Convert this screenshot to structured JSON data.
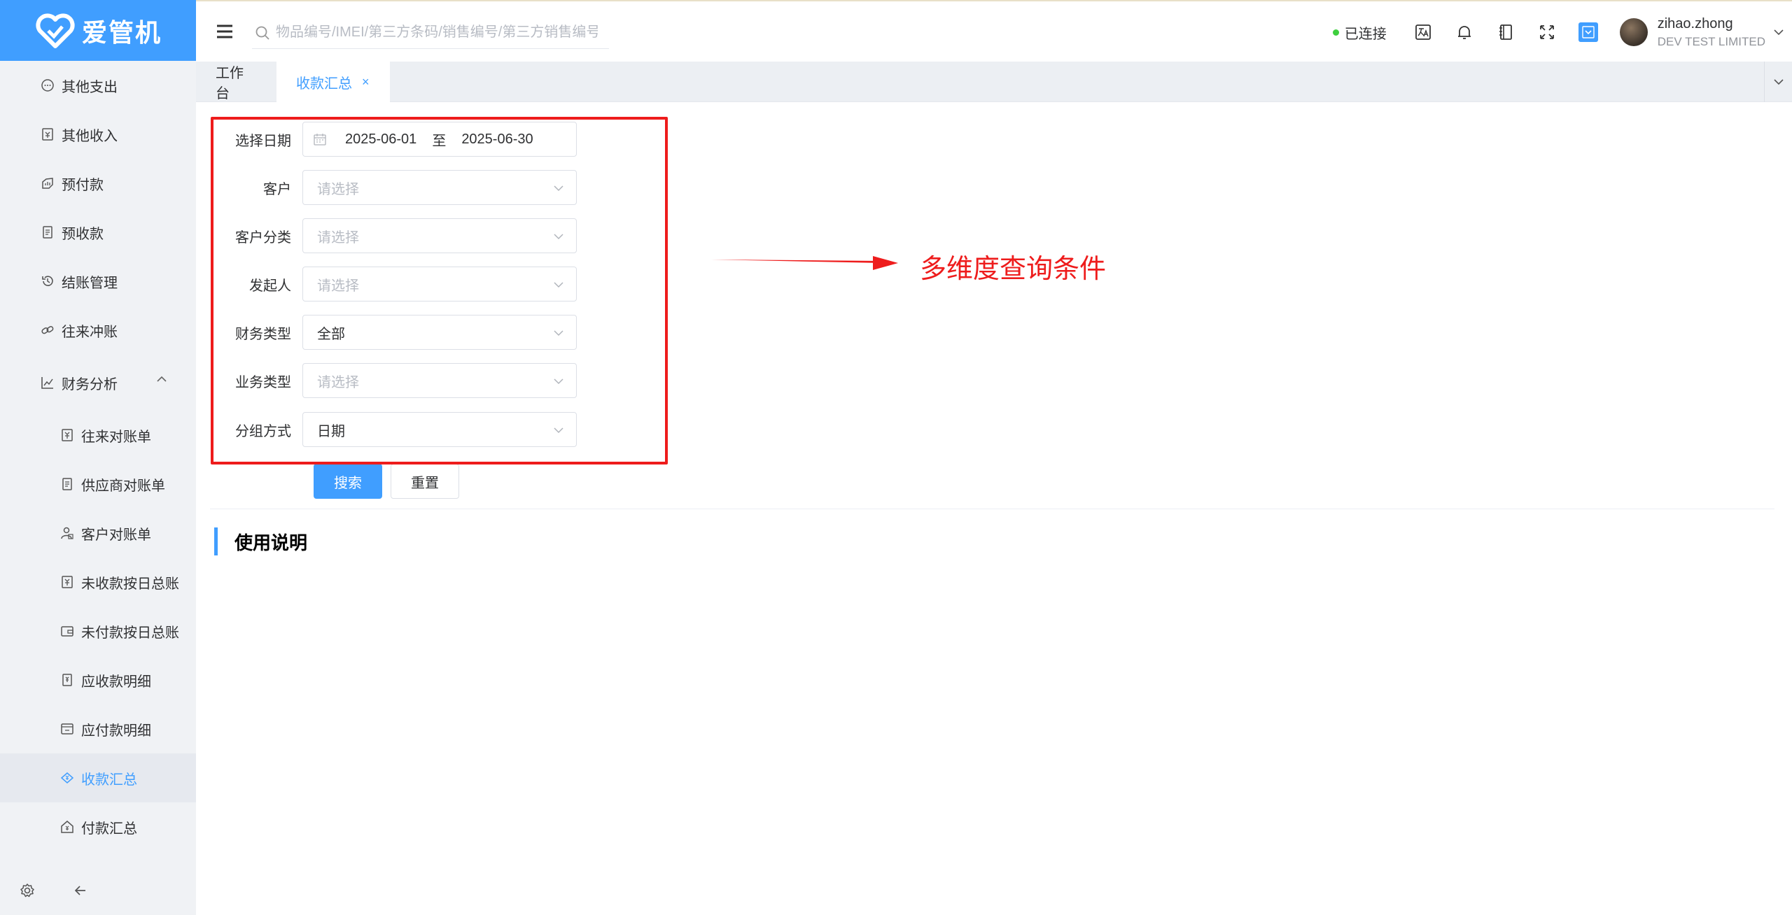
{
  "app": {
    "brand": "爱管机"
  },
  "sidebar": {
    "items": [
      {
        "label": "其他支出",
        "icon": "other-expense-icon"
      },
      {
        "label": "其他收入",
        "icon": "other-income-icon"
      },
      {
        "label": "预付款",
        "icon": "prepayment-icon"
      },
      {
        "label": "预收款",
        "icon": "advance-receipt-icon"
      },
      {
        "label": "结账管理",
        "icon": "history-icon"
      },
      {
        "label": "往来冲账",
        "icon": "link-icon"
      },
      {
        "label": "财务分析",
        "icon": "chart-icon",
        "expanded": true
      }
    ],
    "subitems": [
      {
        "label": "往来对账单",
        "icon": "yen-document-icon"
      },
      {
        "label": "供应商对账单",
        "icon": "document-icon"
      },
      {
        "label": "客户对账单",
        "icon": "user-document-icon"
      },
      {
        "label": "未收款按日总账",
        "icon": "yen-document-icon"
      },
      {
        "label": "未付款按日总账",
        "icon": "wallet-icon"
      },
      {
        "label": "应收款明细",
        "icon": "receipt-icon"
      },
      {
        "label": "应付款明细",
        "icon": "payable-icon"
      },
      {
        "label": "收款汇总",
        "icon": "collection-icon",
        "active": true
      },
      {
        "label": "付款汇总",
        "icon": "payment-icon"
      }
    ]
  },
  "header": {
    "search_placeholder": "物品编号/IMEI/第三方条码/销售编号/第三方销售编号",
    "status": "已连接",
    "user": {
      "name": "zihao.zhong",
      "company": "DEV TEST LIMITED"
    }
  },
  "tabs": [
    {
      "label": "工作台"
    },
    {
      "label": "收款汇总",
      "active": true,
      "close": "×"
    }
  ],
  "form": {
    "date_label": "选择日期",
    "date_start": "2025-06-01",
    "date_sep": "至",
    "date_end": "2025-06-30",
    "fields": [
      {
        "label": "客户",
        "value": "请选择",
        "placeholder": true
      },
      {
        "label": "客户分类",
        "value": "请选择",
        "placeholder": true
      },
      {
        "label": "发起人",
        "value": "请选择",
        "placeholder": true
      },
      {
        "label": "财务类型",
        "value": "全部",
        "placeholder": false
      },
      {
        "label": "业务类型",
        "value": "请选择",
        "placeholder": true
      },
      {
        "label": "分组方式",
        "value": "日期",
        "placeholder": false
      }
    ],
    "search_button": "搜索",
    "reset_button": "重置"
  },
  "annotation": {
    "text": "多维度查询条件",
    "color": "#ee1c1c"
  },
  "section_title": "使用说明",
  "colors": {
    "primary": "#409eff",
    "sidebar_bg": "#f0f2f5",
    "annotation": "#ee1c1c"
  }
}
